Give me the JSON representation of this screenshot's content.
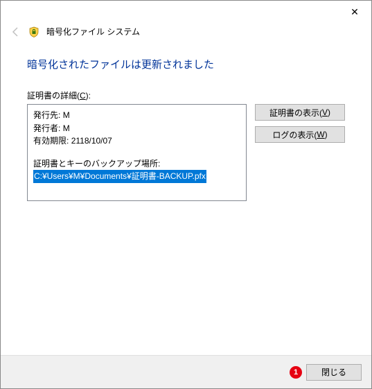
{
  "titlebar": {
    "close_label": "✕"
  },
  "header": {
    "wizard_title": "暗号化ファイル システム"
  },
  "main": {
    "heading": "暗号化されたファイルは更新されました",
    "details_label_pre": "証明書の詳細(",
    "details_label_key": "C",
    "details_label_post": "):",
    "issued_to_label": "発行先:",
    "issued_to_value": "M",
    "issued_by_label": "発行者:",
    "issued_by_value": "M",
    "expiry_label": "有効期限:",
    "expiry_value": "2118/10/07",
    "backup_label": "証明書とキーのバックアップ場所:",
    "backup_path": "C:¥Users¥M¥Documents¥証明書-BACKUP.pfx"
  },
  "buttons": {
    "view_cert_pre": "証明書の表示(",
    "view_cert_key": "V",
    "view_cert_post": ")",
    "view_log_pre": "ログの表示(",
    "view_log_key": "W",
    "view_log_post": ")",
    "close": "閉じる"
  },
  "annotations": {
    "step1": "1"
  }
}
